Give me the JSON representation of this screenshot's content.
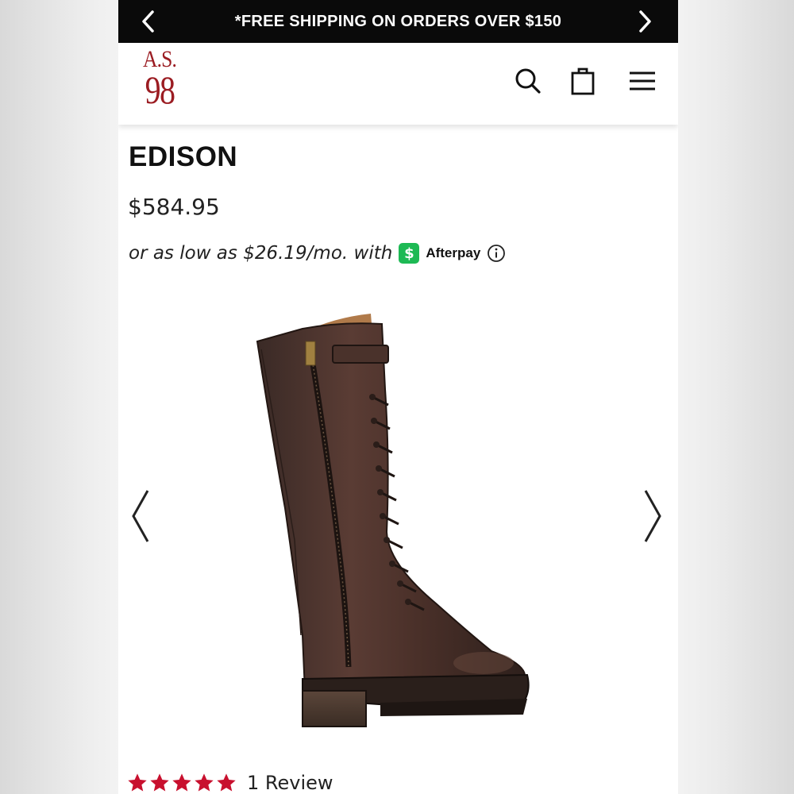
{
  "promo": {
    "text": "*FREE SHIPPING ON ORDERS OVER $150",
    "prev_icon": "chevron-left-icon",
    "next_icon": "chevron-right-icon"
  },
  "header": {
    "logo_line1": "A.S.",
    "logo_line2": "98",
    "logo_color": "#9b1c22",
    "icons": [
      "search-icon",
      "shopping-bag-icon",
      "menu-icon"
    ]
  },
  "product": {
    "title": "EDISON",
    "price": "$584.95",
    "installment_text": "or as low as $26.19/mo. with",
    "afterpay_badge": "$",
    "afterpay_label": "Afterpay",
    "afterpay_color": "#1db954"
  },
  "gallery": {
    "prev_icon": "chevron-left-icon",
    "next_icon": "chevron-right-icon",
    "image": "tall-brown-lace-up-leather-boot"
  },
  "rating": {
    "stars": 5,
    "star_color": "#c8102e",
    "review_text": "1 Review"
  }
}
